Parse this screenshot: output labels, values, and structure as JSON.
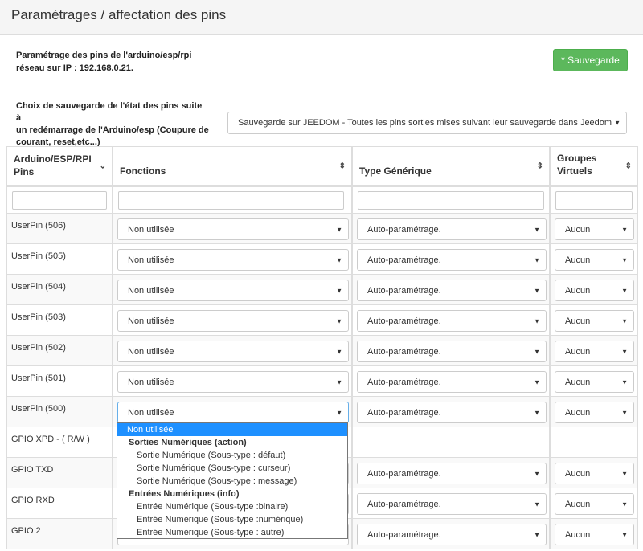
{
  "header": {
    "title": "Paramétrages / affectation des pins"
  },
  "intro": {
    "line1": "Paramétrage des pins de l'arduino/esp/rpi",
    "line2": "réseau sur IP : 192.168.0.21."
  },
  "save_button": {
    "label": "* Sauvegarde"
  },
  "save_choice": {
    "label_line1": "Choix de sauvegarde de l'état des pins suite à",
    "label_line2": "un redémarrage de l'Arduino/esp (Coupure de",
    "label_line3": "courant, reset,etc...)",
    "value": "Sauvegarde sur JEEDOM - Toutes les pins sorties mises suivant leur sauvegarde dans Jeedom"
  },
  "table": {
    "headers": {
      "pins_line1": "Arduino/ESP/RPI",
      "pins_line2": "Pins",
      "fonctions": "Fonctions",
      "type": "Type Générique",
      "groupes_line1": "Groupes",
      "groupes_line2": "Virtuels"
    },
    "rows": [
      {
        "pin": "UserPin (506)",
        "fonction": "Non utilisée",
        "type": "Auto-paramétrage.",
        "groupe": "Aucun"
      },
      {
        "pin": "UserPin (505)",
        "fonction": "Non utilisée",
        "type": "Auto-paramétrage.",
        "groupe": "Aucun"
      },
      {
        "pin": "UserPin (504)",
        "fonction": "Non utilisée",
        "type": "Auto-paramétrage.",
        "groupe": "Aucun"
      },
      {
        "pin": "UserPin (503)",
        "fonction": "Non utilisée",
        "type": "Auto-paramétrage.",
        "groupe": "Aucun"
      },
      {
        "pin": "UserPin (502)",
        "fonction": "Non utilisée",
        "type": "Auto-paramétrage.",
        "groupe": "Aucun"
      },
      {
        "pin": "UserPin (501)",
        "fonction": "Non utilisée",
        "type": "Auto-paramétrage.",
        "groupe": "Aucun"
      },
      {
        "pin": "UserPin (500)",
        "fonction": "Non utilisée",
        "type": "Auto-paramétrage.",
        "groupe": "Aucun"
      },
      {
        "pin": "GPIO XPD - ( R/W )"
      },
      {
        "pin": "GPIO TXD",
        "type": "Auto-paramétrage.",
        "groupe": "Aucun"
      },
      {
        "pin": "GPIO RXD",
        "type": "Auto-paramétrage.",
        "groupe": "Aucun"
      },
      {
        "pin": "GPIO 2",
        "type": "Auto-paramétrage.",
        "groupe": "Aucun"
      }
    ]
  },
  "dropdown": {
    "selected": "Non utilisée",
    "group1": "Sorties Numériques (action)",
    "group1_options": [
      "Sortie Numérique (Sous-type : défaut)",
      "Sortie Numérique (Sous-type : curseur)",
      "Sortie Numérique (Sous-type : message)"
    ],
    "group2": "Entrées Numériques (info)",
    "group2_options": [
      "Entrée Numérique (Sous-type :binaire)",
      "Entrée Numérique (Sous-type :numérique)",
      "Entrée Numérique (Sous-type : autre)"
    ]
  }
}
